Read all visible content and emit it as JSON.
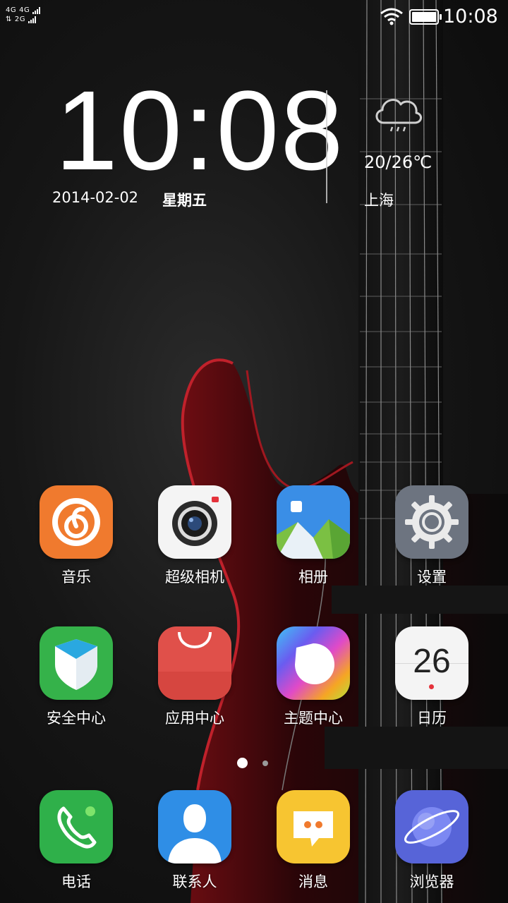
{
  "status_bar": {
    "signal_row1_a": "4G",
    "signal_row1_b": "4G",
    "signal_row2_a": "⇅",
    "signal_row2_b": "2G",
    "time": "10:08"
  },
  "clock_widget": {
    "time": "10:08",
    "date": "2014-02-02",
    "weekday": "星期五",
    "temperature": "20/26℃",
    "city": "上海",
    "weather_icon": "cloud-rain-icon"
  },
  "apps": [
    {
      "label": "音乐",
      "icon": "music-icon",
      "color": "#f07a2e"
    },
    {
      "label": "超级相机",
      "icon": "camera-icon",
      "color": "#f4f4f4"
    },
    {
      "label": "相册",
      "icon": "gallery-icon",
      "color": "#3a8ee6"
    },
    {
      "label": "设置",
      "icon": "gear-icon",
      "color": "#6d7480"
    },
    {
      "label": "安全中心",
      "icon": "shield-icon",
      "color": "#35b24a"
    },
    {
      "label": "应用中心",
      "icon": "shopping-bag-icon",
      "color": "#e0504a"
    },
    {
      "label": "主题中心",
      "icon": "theme-icon",
      "color": "#8a5cf0"
    },
    {
      "label": "日历",
      "icon": "calendar-icon",
      "color": "#f4f4f4",
      "day": "26"
    }
  ],
  "dock": [
    {
      "label": "电话",
      "icon": "phone-icon",
      "color": "#2fb04a"
    },
    {
      "label": "联系人",
      "icon": "contacts-icon",
      "color": "#2f8ee6"
    },
    {
      "label": "消息",
      "icon": "message-icon",
      "color": "#f7c531"
    },
    {
      "label": "浏览器",
      "icon": "browser-icon",
      "color": "#5764d8"
    }
  ],
  "pager": {
    "current_page": 1,
    "total_pages": 2
  }
}
